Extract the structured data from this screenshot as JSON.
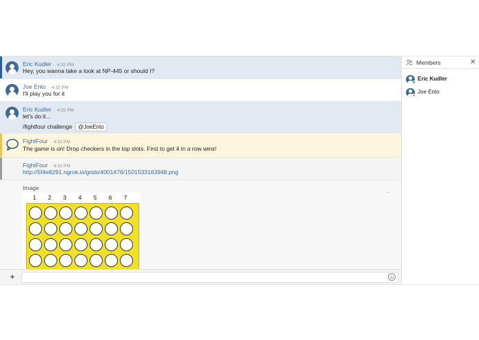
{
  "messages": [
    {
      "author": "Eric Kudler",
      "time": "· 4:32 PM",
      "lines": [
        "Hey, you wanna take a look at NP-445 or should I?"
      ],
      "bg": "#e1e9f2",
      "bar": "#2f5f8c"
    },
    {
      "author": "Joe Ento",
      "time": "· 4:32 PM",
      "lines": [
        "I'll play you for it"
      ],
      "bg": "#ffffff",
      "bar": ""
    },
    {
      "author": "Eric Kudler",
      "time": "· 4:32 PM",
      "lines": [
        "let's do it...",
        "/fightfour challenge"
      ],
      "mention": "@JoeEnto",
      "bg": "#e1e9f2",
      "bar": ""
    },
    {
      "author": "FightFour",
      "time": "· 4:32 PM",
      "lines": [
        "The game is on! Drop checkers in the top slots. First to get 4 in a row wins!"
      ],
      "bg": "#fdf5dc",
      "bar": "#e8c45a"
    },
    {
      "author": "FightFour",
      "time": "· 4:32 PM",
      "link": "http://5f4e8291.ngrok.io/grids/4001476/1501533163948.png",
      "bg": "#f4f4f4",
      "bar": "#9a9a9a"
    }
  ],
  "image_block": {
    "label": "Image",
    "collapse_glyph": "ˆ",
    "columns": [
      "1",
      "2",
      "3",
      "4",
      "5",
      "6",
      "7"
    ],
    "board_color": "#f1df28",
    "visible_rows": 4
  },
  "composer": {
    "add_label": "+",
    "placeholder": ""
  },
  "sidebar": {
    "title": "Members",
    "close_glyph": "✕",
    "members": [
      {
        "name": "Eric Kudler",
        "bold": true
      },
      {
        "name": "Joe Ento",
        "bold": false
      }
    ]
  }
}
